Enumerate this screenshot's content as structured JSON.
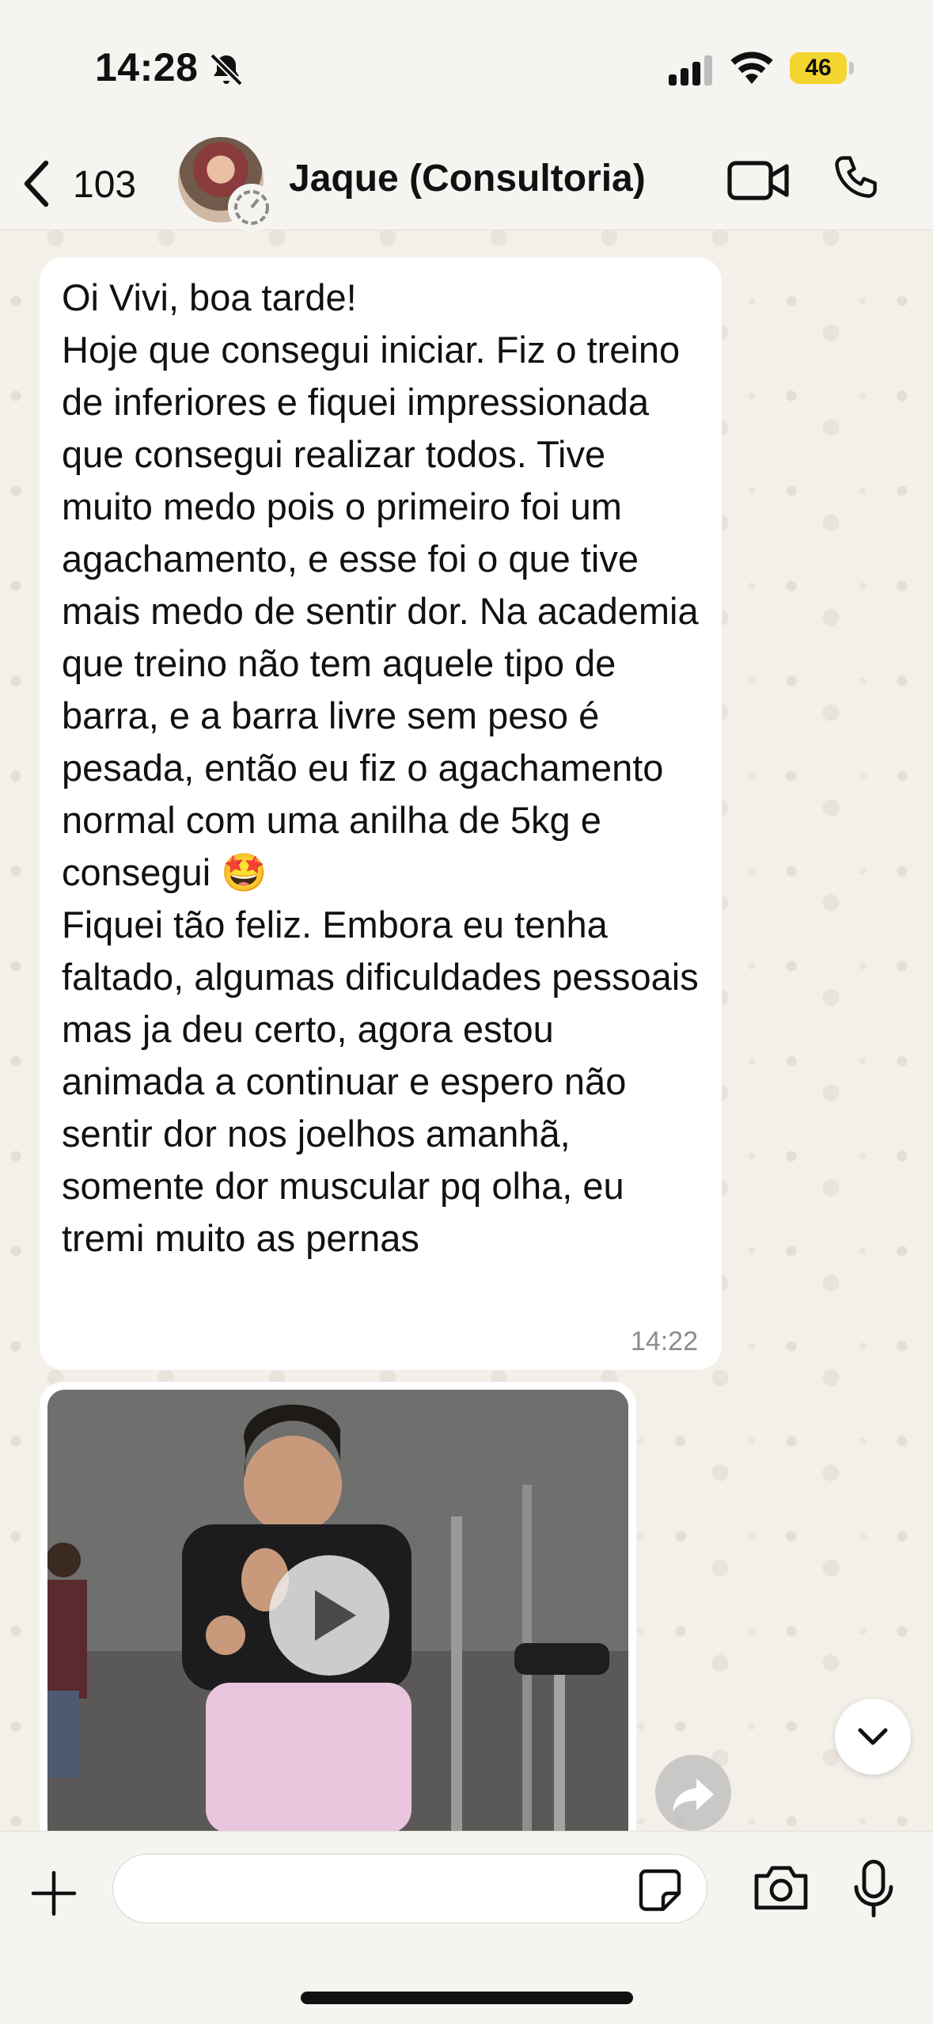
{
  "status_bar": {
    "time": "14:28",
    "battery_level": "46",
    "icons": [
      "bell-slash-icon",
      "signal-icon",
      "wifi-icon",
      "battery-icon"
    ],
    "battery_color": "#f4d52f"
  },
  "header": {
    "back_count": "103",
    "contact_name": "Jaque (Consultoria)",
    "icons": [
      "chevron-left-icon",
      "disappearing-timer-icon",
      "video-call-icon",
      "phone-icon"
    ]
  },
  "messages": [
    {
      "text": "Oi Vivi, boa tarde!\nHoje que consegui iniciar. Fiz o treino de inferiores e fiquei impressionada que consegui realizar todos. Tive muito medo pois o primeiro foi um agachamento, e esse foi o que tive mais medo de sentir dor. Na academia que treino não tem aquele tipo de barra, e a barra livre sem peso é pesada, então eu fiz o agachamento normal com uma anilha de 5kg e consegui 🤩\nFiquei tão feliz. Embora eu tenha faltado, algumas dificuldades pessoais mas ja deu certo, agora estou animada a continuar e espero não sentir dor nos joelhos amanhã, somente dor muscular pq olha, eu tremi muito as pernas",
      "time": "14:22"
    },
    {
      "type": "video",
      "icons": [
        "play-icon",
        "forward-icon"
      ]
    }
  ],
  "composer": {
    "input_value": "",
    "input_placeholder": "",
    "icons": [
      "plus-icon",
      "sticker-icon",
      "camera-icon",
      "microphone-icon",
      "chevron-down-icon"
    ]
  },
  "colors": {
    "chat_background": "#f3efe9",
    "bubble": "#ffffff",
    "bar_background": "#f6f4f1"
  }
}
